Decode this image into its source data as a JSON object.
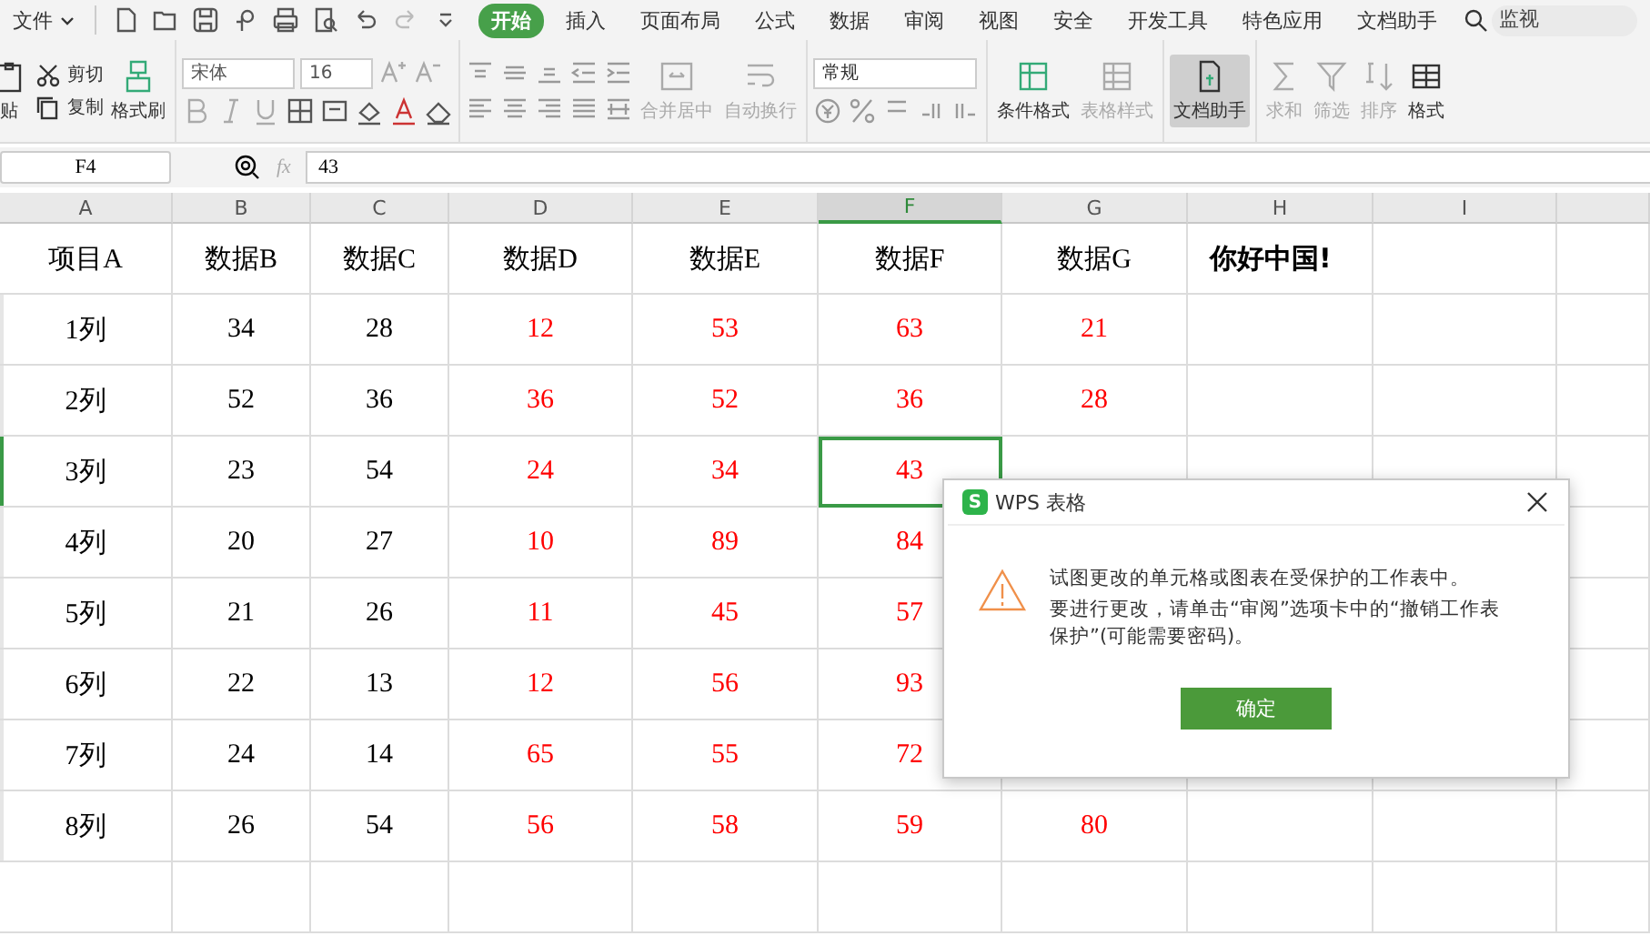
{
  "menubar": {
    "file_menu": "文件",
    "tabs": [
      {
        "label": "开始",
        "selected": true
      },
      {
        "label": "插入",
        "selected": false
      },
      {
        "label": "页面布局",
        "selected": false
      },
      {
        "label": "公式",
        "selected": false
      },
      {
        "label": "数据",
        "selected": false
      },
      {
        "label": "审阅",
        "selected": false
      },
      {
        "label": "视图",
        "selected": false
      },
      {
        "label": "安全",
        "selected": false
      },
      {
        "label": "开发工具",
        "selected": false
      },
      {
        "label": "特色应用",
        "selected": false
      },
      {
        "label": "文档助手",
        "selected": false
      }
    ],
    "search": {
      "placeholder": "监视"
    }
  },
  "ribbon": {
    "paste": "贴",
    "cut": "剪切",
    "copy": "复制",
    "format_painter": "格式刷",
    "font_name": "宋体",
    "font_size": "16",
    "merge": {
      "label": "合并居中",
      "disabled": true
    },
    "wrap": {
      "label": "自动换行",
      "disabled": true
    },
    "number_format": "常规",
    "conditional_format": {
      "label": "条件格式",
      "disabled": false
    },
    "table_style": {
      "label": "表格样式",
      "disabled": true
    },
    "assistant": {
      "label": "文档助手",
      "selected": true
    },
    "tools": [
      {
        "label": "求和",
        "disabled": true
      },
      {
        "label": "筛选",
        "disabled": true
      },
      {
        "label": "排序",
        "disabled": true
      },
      {
        "label": "格式",
        "disabled": false
      }
    ]
  },
  "formula_bar": {
    "name_box": "F4",
    "fx": "fx",
    "value": "43"
  },
  "sheet": {
    "columns": [
      {
        "label": "A",
        "selected": false
      },
      {
        "label": "B",
        "selected": false
      },
      {
        "label": "C",
        "selected": false
      },
      {
        "label": "D",
        "selected": false
      },
      {
        "label": "E",
        "selected": false
      },
      {
        "label": "F",
        "selected": true
      },
      {
        "label": "G",
        "selected": false
      },
      {
        "label": "H",
        "selected": false
      },
      {
        "label": "I",
        "selected": false
      }
    ],
    "header_row": [
      {
        "text": "项目A",
        "bold": false
      },
      {
        "text": "数据B",
        "bold": false
      },
      {
        "text": "数据C",
        "bold": false
      },
      {
        "text": "数据D",
        "bold": false
      },
      {
        "text": "数据E",
        "bold": false
      },
      {
        "text": "数据F",
        "bold": false
      },
      {
        "text": "数据G",
        "bold": false
      },
      {
        "text": "你好中国!",
        "bold": true
      }
    ],
    "rows": [
      {
        "selected": false,
        "cells": [
          {
            "text": "1列",
            "color": "#000000"
          },
          {
            "text": "34",
            "color": "#000000"
          },
          {
            "text": "28",
            "color": "#000000"
          },
          {
            "text": "12",
            "color": "#ff0000"
          },
          {
            "text": "53",
            "color": "#ff0000"
          },
          {
            "text": "63",
            "color": "#ff0000"
          },
          {
            "text": "21",
            "color": "#ff0000"
          }
        ]
      },
      {
        "selected": false,
        "cells": [
          {
            "text": "2列",
            "color": "#000000"
          },
          {
            "text": "52",
            "color": "#000000"
          },
          {
            "text": "36",
            "color": "#000000"
          },
          {
            "text": "36",
            "color": "#ff0000"
          },
          {
            "text": "52",
            "color": "#ff0000"
          },
          {
            "text": "36",
            "color": "#ff0000"
          },
          {
            "text": "28",
            "color": "#ff0000"
          }
        ]
      },
      {
        "selected": true,
        "cells": [
          {
            "text": "3列",
            "color": "#000000"
          },
          {
            "text": "23",
            "color": "#000000"
          },
          {
            "text": "54",
            "color": "#000000"
          },
          {
            "text": "24",
            "color": "#ff0000"
          },
          {
            "text": "34",
            "color": "#ff0000"
          },
          {
            "text": "43",
            "color": "#ff0000"
          }
        ]
      },
      {
        "selected": false,
        "cells": [
          {
            "text": "4列",
            "color": "#000000"
          },
          {
            "text": "20",
            "color": "#000000"
          },
          {
            "text": "27",
            "color": "#000000"
          },
          {
            "text": "10",
            "color": "#ff0000"
          },
          {
            "text": "89",
            "color": "#ff0000"
          },
          {
            "text": "84",
            "color": "#ff0000"
          }
        ]
      },
      {
        "selected": false,
        "cells": [
          {
            "text": "5列",
            "color": "#000000"
          },
          {
            "text": "21",
            "color": "#000000"
          },
          {
            "text": "26",
            "color": "#000000"
          },
          {
            "text": "11",
            "color": "#ff0000"
          },
          {
            "text": "45",
            "color": "#ff0000"
          },
          {
            "text": "57",
            "color": "#ff0000"
          }
        ]
      },
      {
        "selected": false,
        "cells": [
          {
            "text": "6列",
            "color": "#000000"
          },
          {
            "text": "22",
            "color": "#000000"
          },
          {
            "text": "13",
            "color": "#000000"
          },
          {
            "text": "12",
            "color": "#ff0000"
          },
          {
            "text": "56",
            "color": "#ff0000"
          },
          {
            "text": "93",
            "color": "#ff0000"
          }
        ]
      },
      {
        "selected": false,
        "cells": [
          {
            "text": "7列",
            "color": "#000000"
          },
          {
            "text": "24",
            "color": "#000000"
          },
          {
            "text": "14",
            "color": "#000000"
          },
          {
            "text": "65",
            "color": "#ff0000"
          },
          {
            "text": "55",
            "color": "#ff0000"
          },
          {
            "text": "72",
            "color": "#ff0000"
          }
        ]
      },
      {
        "selected": false,
        "cells": [
          {
            "text": "8列",
            "color": "#000000"
          },
          {
            "text": "26",
            "color": "#000000"
          },
          {
            "text": "54",
            "color": "#000000"
          },
          {
            "text": "56",
            "color": "#ff0000"
          },
          {
            "text": "58",
            "color": "#ff0000"
          },
          {
            "text": "59",
            "color": "#ff0000"
          },
          {
            "text": "80",
            "color": "#ff0000"
          }
        ]
      }
    ]
  },
  "dialog": {
    "title": "WPS 表格",
    "app_icon": "S",
    "kind": "warning",
    "lines": [
      "试图更改的单元格或图表在受保护的工作表中。",
      "要进行更改，请单击“审阅”选项卡中的“撤销工作表保护”(可能需要密码)。"
    ],
    "button": "确定"
  }
}
